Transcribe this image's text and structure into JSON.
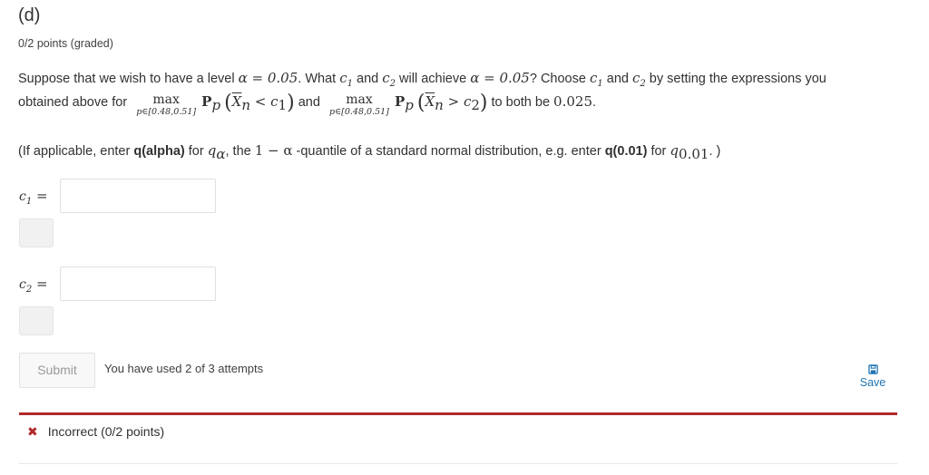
{
  "problem": {
    "title": "(d)",
    "points": "0/2 points (graded)",
    "line1": {
      "t1": "Suppose that we wish to have a level ",
      "alpha_eq": "α = 0.05",
      "t2": ". What ",
      "c1": "c",
      "c1_sub": "1",
      "t3": " and ",
      "c2": "c",
      "c2_sub": "2",
      "t4": " will achieve ",
      "alpha_eq2": "α = 0.05",
      "t5": "? Choose ",
      "t6": " and ",
      "t7": " by setting the expressions you"
    },
    "line2": {
      "t1": "obtained above for",
      "max": "max",
      "range": "p∈[0.48,0.51]",
      "P": "P",
      "P_sub": "p",
      "X": "X",
      "X_sub": "n",
      "lt": " < ",
      "gt": " > ",
      "t2": "and",
      "t3": "to both be ",
      "val": "0.025",
      "t4": "."
    },
    "line3": {
      "t1": "(If applicable, enter ",
      "b1": "q(alpha)",
      "t2": " for ",
      "q": "q",
      "q_sub": "α",
      "t3": ", the ",
      "expr": "1 − α",
      "t4": " -quantile of a standard normal distribution, e.g. enter ",
      "b2": "q(0.01)",
      "t5": " for ",
      "q2_sub": "0.01",
      "t6": ". )"
    }
  },
  "inputs": [
    {
      "label": "c",
      "sub": "1",
      "eq": " =",
      "value": ""
    },
    {
      "label": "c",
      "sub": "2",
      "eq": " =",
      "value": ""
    }
  ],
  "actions": {
    "submit_label": "Submit",
    "attempts_text": "You have used 2 of 3 attempts",
    "save_label": "Save",
    "save_icon": "floppy-disk-icon"
  },
  "feedback": {
    "icon": "✖",
    "text": "Incorrect (0/2 points)",
    "color": "#b02a2a"
  },
  "colors": {
    "accent": "#1d73b5",
    "error": "#b02a2a"
  }
}
